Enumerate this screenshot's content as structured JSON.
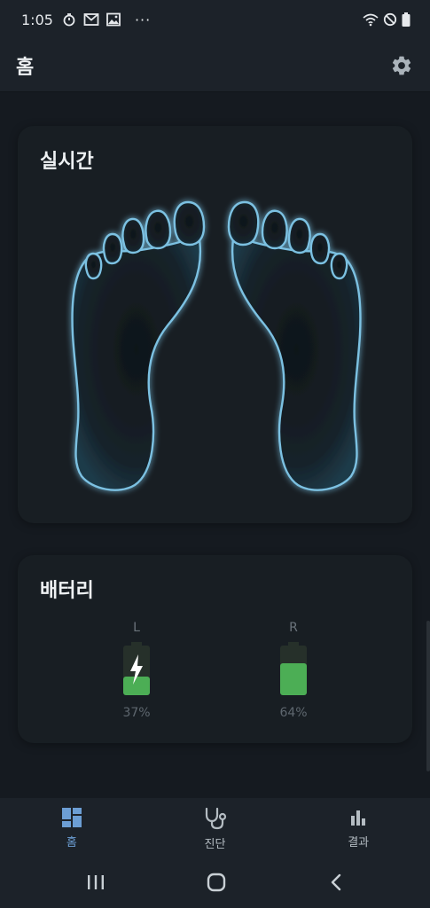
{
  "status_bar": {
    "time": "1:05",
    "notification_icons": [
      "timer-icon",
      "gmail-icon",
      "gallery-icon",
      "more-dots-icon"
    ],
    "system_icons": [
      "wifi-icon",
      "do-not-disturb-icon",
      "battery-icon"
    ],
    "more_text": "···"
  },
  "app_bar": {
    "title": "홈",
    "settings_icon": "gear-icon"
  },
  "realtime_card": {
    "title": "실시간",
    "glow_color": "#6fb8dc"
  },
  "battery_card": {
    "title": "배터리",
    "left": {
      "label": "L",
      "percent_text": "37%",
      "level": 0.37,
      "charging": true
    },
    "right": {
      "label": "R",
      "percent_text": "64%",
      "level": 0.64,
      "charging": false
    },
    "fill_color": "#4cae55"
  },
  "bottom_nav": {
    "items": [
      {
        "label": "홈",
        "icon": "dashboard-icon",
        "active": true
      },
      {
        "label": "진단",
        "icon": "stethoscope-icon",
        "active": false
      },
      {
        "label": "결과",
        "icon": "bar-chart-icon",
        "active": false
      }
    ],
    "active_color": "#6c9ed4"
  },
  "system_nav": {
    "icons": [
      "recent-apps-icon",
      "home-icon",
      "back-icon"
    ]
  }
}
